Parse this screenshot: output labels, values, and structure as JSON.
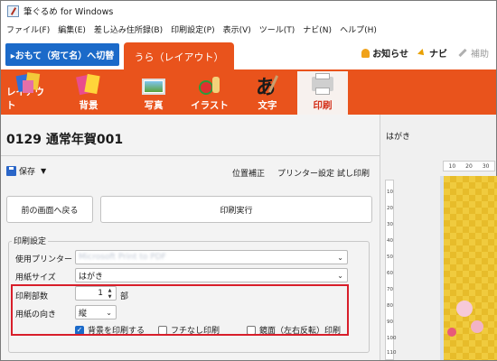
{
  "app": {
    "title": "筆ぐるめ for Windows"
  },
  "menu": [
    "ファイル(F)",
    "編集(E)",
    "差し込み住所録(B)",
    "印刷設定(P)",
    "表示(V)",
    "ツール(T)",
    "ナビ(N)",
    "ヘルプ(H)"
  ],
  "tabs": {
    "front": "▸おもて（宛て名）へ切替",
    "back": "うら（レイアウト）"
  },
  "right_links": {
    "news": "お知らせ",
    "navi": "ナビ",
    "assist": "補助"
  },
  "ribbon": [
    {
      "label": "レイアウト",
      "icon": "layout-icon"
    },
    {
      "label": "背景",
      "icon": "background-icon"
    },
    {
      "label": "写真",
      "icon": "photo-icon"
    },
    {
      "label": "イラスト",
      "icon": "illustration-icon"
    },
    {
      "label": "文字",
      "icon": "text-icon"
    },
    {
      "label": "印刷",
      "icon": "printer-icon",
      "active": true
    }
  ],
  "doc": {
    "title": "0129 通常年賀001"
  },
  "toolbar": {
    "save": "保存",
    "position": "位置補正",
    "printer_settings": "プリンター設定",
    "test_print": "試し印刷"
  },
  "actions": {
    "back": "前の画面へ戻る",
    "print": "印刷実行"
  },
  "settings": {
    "group_title": "印刷設定",
    "printer_label": "使用プリンター",
    "printer_value": "Microsoft Print to PDF",
    "paper_label": "用紙サイズ",
    "paper_value": "はがき",
    "copies_label": "印刷部数",
    "copies_value": "1",
    "copies_unit": "部",
    "orientation_label": "用紙の向き",
    "orientation_value": "縦",
    "print_bg": "背景を印刷する",
    "print_bg_checked": true,
    "borderless": "フチなし印刷",
    "borderless_checked": false,
    "mirror": "鏡面（左右反転）印刷",
    "mirror_checked": false
  },
  "preview": {
    "title": "はがき",
    "ruler_h": [
      "10",
      "20",
      "30"
    ],
    "ruler_v": [
      "10",
      "20",
      "30",
      "40",
      "50",
      "60",
      "70",
      "80",
      "90",
      "100",
      "110"
    ]
  },
  "colors": {
    "accent": "#e9531c",
    "front_tab": "#1b6ac9",
    "highlight": "#d81e2a"
  }
}
